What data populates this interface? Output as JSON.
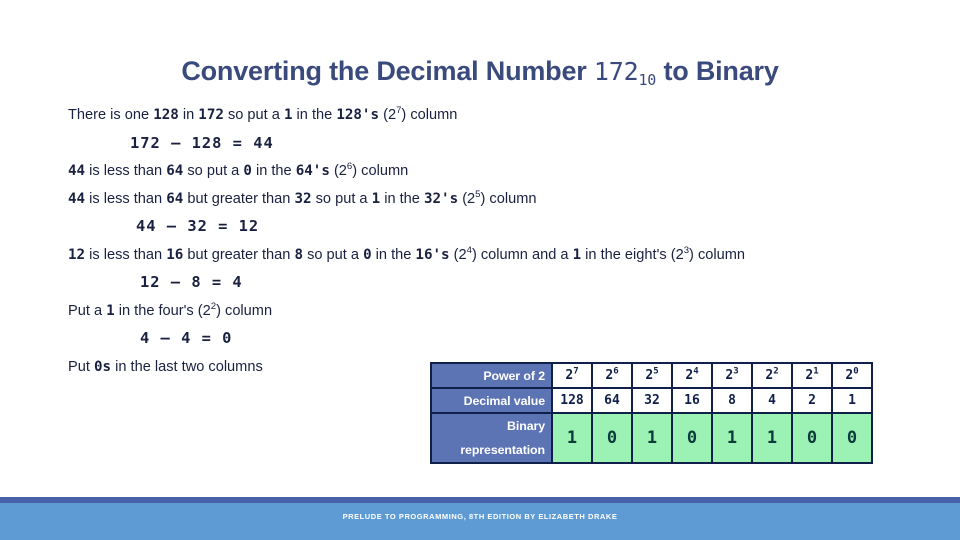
{
  "slide": {
    "title_prefix": "Converting the Decimal Number ",
    "title_number": "172",
    "title_subscript": "10",
    "title_suffix": " to Binary",
    "title_color": "#3A4A7D"
  },
  "body_lines": [
    {
      "id": "line-1",
      "text": "There is one 128  in 172 so put a 1  in the 128's (2⁷) column",
      "parts": [
        {
          "t": "There is one ",
          "s": "plain"
        },
        {
          "t": "128",
          "s": "num"
        },
        {
          "t": "  in ",
          "s": "plain"
        },
        {
          "t": "172",
          "s": "num"
        },
        {
          "t": " so put a ",
          "s": "plain"
        },
        {
          "t": "1",
          "s": "num"
        },
        {
          "t": "  in the ",
          "s": "plain"
        },
        {
          "t": "128's",
          "s": "num"
        },
        {
          "t": " (2",
          "s": "plain"
        },
        {
          "t": "7",
          "s": "sup"
        },
        {
          "t": ") column",
          "s": "plain"
        }
      ]
    },
    {
      "id": "line-2",
      "text": "172 – 128 = 44",
      "parts": [
        {
          "t": "172 – 128 = 44",
          "s": "eq"
        }
      ]
    },
    {
      "id": "line-3",
      "text": "44  is less than 64 so put a 0  in the 64's (2⁶) column",
      "parts": [
        {
          "t": "44",
          "s": "num"
        },
        {
          "t": "  is less than ",
          "s": "plain"
        },
        {
          "t": "64",
          "s": "num"
        },
        {
          "t": " so put a ",
          "s": "plain"
        },
        {
          "t": "0",
          "s": "num"
        },
        {
          "t": "  in the ",
          "s": "plain"
        },
        {
          "t": "64's",
          "s": "num"
        },
        {
          "t": " (2",
          "s": "plain"
        },
        {
          "t": "6",
          "s": "sup"
        },
        {
          "t": ") column",
          "s": "plain"
        }
      ]
    },
    {
      "id": "line-4",
      "text": "44  is less than 64  but greater than 32  so put a  1  in the  32's  (2⁵)  column",
      "parts": [
        {
          "t": "44",
          "s": "num"
        },
        {
          "t": "  is less than ",
          "s": "plain"
        },
        {
          "t": "64",
          "s": "num"
        },
        {
          "t": "  but greater than ",
          "s": "plain"
        },
        {
          "t": "32",
          "s": "num"
        },
        {
          "t": "  so put a  ",
          "s": "plain"
        },
        {
          "t": "1",
          "s": "num"
        },
        {
          "t": "  in the  ",
          "s": "plain"
        },
        {
          "t": "32's",
          "s": "num"
        },
        {
          "t": "  (2",
          "s": "plain"
        },
        {
          "t": "5",
          "s": "sup"
        },
        {
          "t": ")  column",
          "s": "plain"
        }
      ]
    },
    {
      "id": "line-5",
      "text": "44 – 32 = 12",
      "parts": [
        {
          "t": "44 – 32 = 12",
          "s": "eq"
        }
      ]
    },
    {
      "id": "line-6",
      "text": "12 is less than 16 but greater than 8 so put a 0  in the 16's (2⁴) column and a 1  in the eight's (2³) column",
      "parts": [
        {
          "t": "12",
          "s": "num"
        },
        {
          "t": " is less than ",
          "s": "plain"
        },
        {
          "t": "16",
          "s": "num"
        },
        {
          "t": " but greater than ",
          "s": "plain"
        },
        {
          "t": "8",
          "s": "num"
        },
        {
          "t": " so put a ",
          "s": "plain"
        },
        {
          "t": "0",
          "s": "num"
        },
        {
          "t": "  in the ",
          "s": "plain"
        },
        {
          "t": "16's",
          "s": "num"
        },
        {
          "t": " (2",
          "s": "plain"
        },
        {
          "t": "4",
          "s": "sup"
        },
        {
          "t": ") column and a ",
          "s": "plain"
        },
        {
          "t": "1",
          "s": "num"
        },
        {
          "t": "  in the eight's (2",
          "s": "plain"
        },
        {
          "t": "3",
          "s": "sup"
        },
        {
          "t": ") column",
          "s": "plain"
        }
      ]
    },
    {
      "id": "line-7",
      "text": "12 – 8 = 4",
      "parts": [
        {
          "t": "12 – 8 = 4",
          "s": "eq"
        }
      ]
    },
    {
      "id": "line-8",
      "text": "Put a 1  in the four's (2²) column",
      "parts": [
        {
          "t": "Put a ",
          "s": "plain"
        },
        {
          "t": "1",
          "s": "num"
        },
        {
          "t": "  in the four's (2",
          "s": "plain"
        },
        {
          "t": "2",
          "s": "sup"
        },
        {
          "t": ") column",
          "s": "plain"
        }
      ]
    },
    {
      "id": "line-9",
      "text": "4 – 4 = 0",
      "parts": [
        {
          "t": "4 – 4 = 0",
          "s": "eq"
        }
      ]
    },
    {
      "id": "line-10",
      "text": "Put 0s in the last two columns",
      "parts": [
        {
          "t": "Put ",
          "s": "plain"
        },
        {
          "t": "0s",
          "s": "num"
        },
        {
          "t": " in the last two columns",
          "s": "plain"
        }
      ]
    }
  ],
  "table": {
    "row_labels": {
      "power": "Power of 2",
      "decimal": "Decimal value",
      "binary_l1": "Binary",
      "binary_l2": "representation"
    },
    "exponents": [
      "7",
      "6",
      "5",
      "4",
      "3",
      "2",
      "1",
      "0"
    ],
    "base": "2",
    "decimal_values": [
      "128",
      "64",
      "32",
      "16",
      "8",
      "4",
      "2",
      "1"
    ],
    "binary_bits": [
      "1",
      "0",
      "1",
      "0",
      "1",
      "1",
      "0",
      "0"
    ],
    "header_bg": "#5C74B4",
    "bit_bg": "#9CF2B4",
    "border_color": "#10204A"
  },
  "footer": {
    "text": "PRELUDE TO PROGRAMMING, 8TH EDITION BY ELIZABETH DRAKE",
    "strip_color": "#4661A8",
    "band_color": "#5E9BD5"
  }
}
